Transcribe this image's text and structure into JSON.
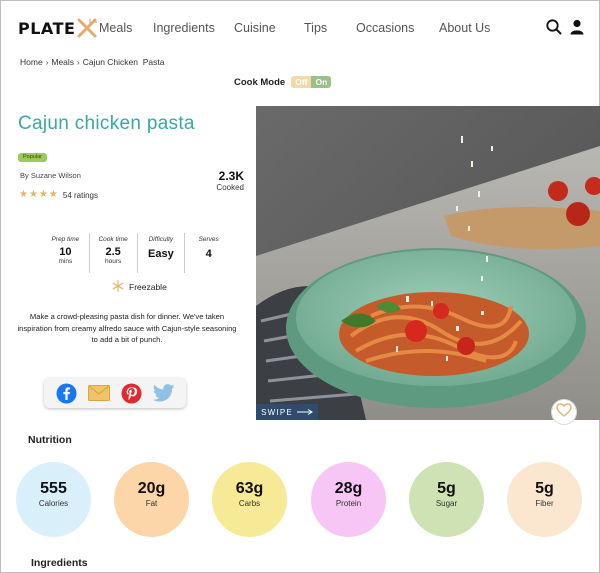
{
  "brand": {
    "logo_text": "PLATE"
  },
  "nav": {
    "items": [
      "Meals",
      "Ingredients",
      "Cuisine",
      "Tips",
      "Occasions",
      "About Us"
    ]
  },
  "header_icons": [
    "search-icon",
    "user-icon"
  ],
  "breadcrumb": [
    "Home",
    "Meals",
    "Cajun Chicken  Pasta"
  ],
  "cook_mode": {
    "label": "Cook Mode",
    "off": "Off",
    "on": "On",
    "state": "off"
  },
  "recipe": {
    "title": "Cajun chicken pasta",
    "badge": "Popular",
    "author": "By Suzane Wilson",
    "rating_stars": 4,
    "ratings": "54 ratings",
    "cooked_count": "2.3K",
    "cooked_label": "Cooked",
    "stats": [
      {
        "label": "Prep time",
        "value": "10",
        "sub": "mins"
      },
      {
        "label": "Cook time",
        "value": "2.5",
        "sub": "hours"
      },
      {
        "label": "Difficulty",
        "value": "Easy",
        "sub": ""
      },
      {
        "label": "Serves",
        "value": "4",
        "sub": ""
      }
    ],
    "freezable": "Freezable",
    "description": "Make a crowd-pleasing pasta dish for dinner. We've taken inspiration from creamy alfredo sauce with Cajun-style seasoning to add a bit of punch."
  },
  "share": [
    "facebook-icon",
    "email-icon",
    "pinterest-icon",
    "twitter-icon"
  ],
  "hero": {
    "swipe_label": "SWIPE"
  },
  "colors": {
    "accent": "#3aa7a0",
    "badge": "#9bc95a",
    "star": "#e6b36a",
    "swipe_bg": "#2f4b6e"
  },
  "nutrition": {
    "title": "Nutrition",
    "items": [
      {
        "value": "555",
        "label": "Calories",
        "color": "#d9f0fb"
      },
      {
        "value": "20g",
        "label": "Fat",
        "color": "#fcd6a8"
      },
      {
        "value": "63g",
        "label": "Carbs",
        "color": "#f6ea96"
      },
      {
        "value": "28g",
        "label": "Protein",
        "color": "#f8c6f4"
      },
      {
        "value": "5g",
        "label": "Sugar",
        "color": "#cfe2b4"
      },
      {
        "value": "5g",
        "label": "Fiber",
        "color": "#fbe6cf"
      }
    ]
  },
  "ingredients": {
    "title": "Ingredients"
  }
}
